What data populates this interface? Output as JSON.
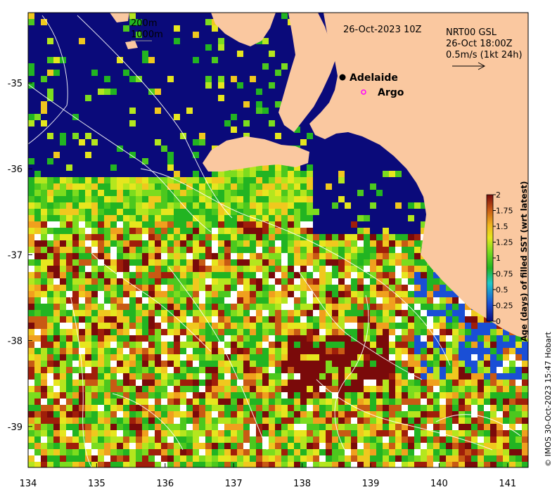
{
  "map": {
    "date_label": "26-Oct-2023 10Z",
    "overlay_lines": [
      "NRT00 GSL",
      "26-Oct 18:00Z",
      "0.5m/s (1kt 24h)"
    ],
    "contour_legend": [
      "200m",
      "1000m"
    ],
    "places": [
      {
        "name": "Adelaide",
        "lon": 138.6,
        "lat": -34.93,
        "marker": "filled-dot",
        "color": "#000000"
      },
      {
        "name": "Argo",
        "lon": 138.8,
        "lat": -35.12,
        "marker": "open-circle",
        "color": "#ff00ff"
      }
    ],
    "lon_ticks": [
      "134",
      "135",
      "136",
      "137",
      "138",
      "139",
      "140",
      "141"
    ],
    "lat_ticks": [
      "-35",
      "-36",
      "-37",
      "-38",
      "-39"
    ],
    "lon_range": [
      134,
      141.3
    ],
    "lat_range": [
      -34.25,
      -39.5
    ],
    "colors": {
      "land": "#fac8a0",
      "no_data_sea": "#0a0a7a",
      "current_lines": "#ffffff",
      "frame": "#000000"
    }
  },
  "colorbar": {
    "title": "Age (days) of filled SST (wrt latest)",
    "tick_labels": [
      "0",
      "0.25",
      "0.5",
      "0.75",
      "1",
      "1.25",
      "1.5",
      "1.75",
      "2"
    ],
    "range": [
      0,
      2
    ],
    "colormap": [
      "#0a0a7a",
      "#1a4fd6",
      "#1ec8c8",
      "#22b422",
      "#7cdc1e",
      "#e6e61e",
      "#f0b41e",
      "#c85a14",
      "#7a0a0a"
    ]
  },
  "credit": "© IMOS 30-Oct-2023 15:47 Hobart"
}
